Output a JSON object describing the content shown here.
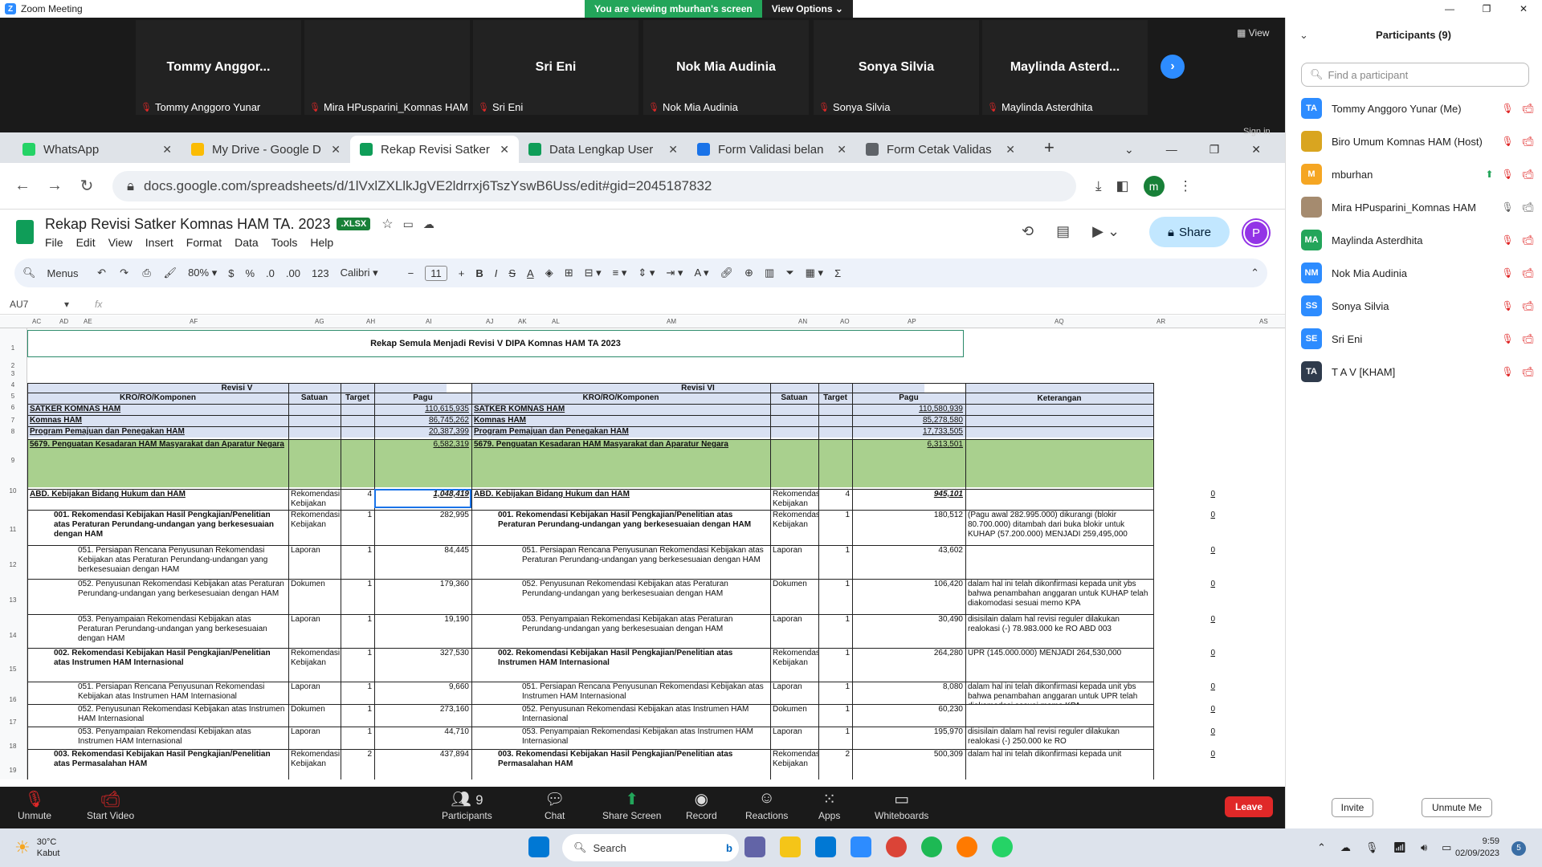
{
  "zoom": {
    "window_title": "Zoom Meeting",
    "banner_text": "You are viewing mburhan's screen",
    "view_options": "View Options",
    "view_label": "View",
    "tiles": [
      {
        "name": "Tommy  Anggor...",
        "label": "Tommy Anggoro Yunar"
      },
      {
        "name": "",
        "label": "Mira HPusparini_Komnas HAM"
      },
      {
        "name": "Sri Eni",
        "label": "Sri Eni"
      },
      {
        "name": "Nok Mia Audinia",
        "label": "Nok Mia Audinia"
      },
      {
        "name": "Sonya Silvia",
        "label": "Sonya Silvia"
      },
      {
        "name": "Maylinda  Asterd...",
        "label": "Maylinda Asterdhita"
      }
    ],
    "toolbar": {
      "unmute": "Unmute",
      "start_video": "Start Video",
      "participants": "Participants",
      "participants_count": "9",
      "chat": "Chat",
      "share_screen": "Share Screen",
      "record": "Record",
      "reactions": "Reactions",
      "apps": "Apps",
      "whiteboards": "Whiteboards",
      "leave": "Leave"
    }
  },
  "participants_panel": {
    "title": "Participants (9)",
    "search_placeholder": "Find a participant",
    "items": [
      {
        "initials": "TA",
        "name": "Tommy Anggoro Yunar (Me)",
        "color": "#2d8cff"
      },
      {
        "initials": "",
        "name": "Biro Umum Komnas HAM (Host)",
        "color": "#d9a520"
      },
      {
        "initials": "M",
        "name": "mburhan",
        "color": "#f5a623"
      },
      {
        "initials": "",
        "name": "Mira HPusparini_Komnas HAM",
        "color": "#a58b6f"
      },
      {
        "initials": "MA",
        "name": "Maylinda Asterdhita",
        "color": "#23a55a"
      },
      {
        "initials": "NM",
        "name": "Nok Mia Audinia",
        "color": "#2d8cff"
      },
      {
        "initials": "SS",
        "name": "Sonya Silvia",
        "color": "#2d8cff"
      },
      {
        "initials": "SE",
        "name": "Sri Eni",
        "color": "#2d8cff"
      },
      {
        "initials": "TA",
        "name": "T A V [KHAM]",
        "color": "#2f3b4c"
      }
    ],
    "invite": "Invite",
    "unmute_me": "Unmute Me"
  },
  "browser": {
    "tabs": [
      {
        "title": "WhatsApp",
        "color": "#25d366"
      },
      {
        "title": "My Drive - Google D",
        "color": "#fbbc04"
      },
      {
        "title": "Rekap Revisi Satker",
        "color": "#0f9d58"
      },
      {
        "title": "Data Lengkap User",
        "color": "#0f9d58"
      },
      {
        "title": "Form Validasi belan",
        "color": "#1a73e8"
      },
      {
        "title": "Form Cetak Validas",
        "color": "#5f6368"
      }
    ],
    "sign_in": "Sign in",
    "url": "docs.google.com/spreadsheets/d/1lVxlZXLlkJgVE2ldrrxj6TszYswB6Uss/edit#gid=2045187832",
    "profile_initial": "m"
  },
  "sheet": {
    "title": "Rekap Revisi Satker Komnas HAM TA. 2023",
    "badge": ".XLSX",
    "menus": [
      "File",
      "Edit",
      "View",
      "Insert",
      "Format",
      "Data",
      "Tools",
      "Help"
    ],
    "share": "Share",
    "avatar": "P",
    "toolbar": {
      "menus": "Menus",
      "zoom": "80%",
      "font": "Calibri",
      "size": "11",
      "currency": "$",
      "percent": "%",
      "dec_less": ".0",
      "dec_more": ".00",
      "fmt": "123"
    },
    "cell_ref": "AU7",
    "fx": "fx",
    "col_headers": [
      "AC",
      "AD",
      "AE",
      "AF",
      "AG",
      "AH",
      "AI",
      "AJ",
      "AK",
      "AL",
      "AM",
      "AN",
      "AO",
      "AP",
      "AQ",
      "AR",
      "AS"
    ],
    "row_numbers": [
      "1",
      "2",
      "3",
      "4",
      "5",
      "6",
      "7",
      "8",
      "9",
      "10",
      "11",
      "12",
      "13",
      "14",
      "15",
      "16",
      "17",
      "18",
      "19"
    ],
    "main_title": "Rekap Semula Menjadi Revisi V DIPA Komnas HAM TA 2023",
    "left_header": "Revisi V",
    "right_header": "Revisi VI",
    "col_kro": "KRO/RO/Komponen",
    "col_satuan": "Satuan",
    "col_target": "Target",
    "col_pagu": "Pagu",
    "col_ket": "Keterangan",
    "rows": [
      {
        "l": "SATKER KOMNAS HAM",
        "lp": "110,615,935",
        "r": "SATKER KOMNAS HAM",
        "rp": "110,580,939"
      },
      {
        "l": "Komnas HAM",
        "lp": "86,745,262",
        "r": "Komnas HAM",
        "rp": "85,278,580"
      },
      {
        "l": "Program Pemajuan dan Penegakan HAM",
        "lp": "20,387,399",
        "r": "Program Pemajuan dan Penegakan HAM",
        "rp": "17,733,505"
      },
      {
        "l": "5679. Penguatan Kesadaran HAM Masyarakat dan Aparatur Negara",
        "lp": "6,582,319",
        "r": "5679. Penguatan Kesadaran HAM Masyarakat dan Aparatur Negara",
        "rp": "6,313,501"
      },
      {
        "l": "ABD. Kebijakan Bidang Hukum dan HAM",
        "ls": "Rekomendasi Kebijakan",
        "lt": "4",
        "lp": "1,048,419",
        "r": "ABD. Kebijakan Bidang Hukum dan HAM",
        "rs": "Rekomendasi Kebijakan",
        "rt": "4",
        "rp": "945,101",
        "z": "0"
      },
      {
        "l": "001. Rekomendasi Kebijakan Hasil Pengkajian/Penelitian atas Peraturan Perundang-undangan yang berkesesuaian dengan HAM",
        "ls": "Rekomendasi Kebijakan",
        "lt": "1",
        "lp": "282,995",
        "r": "001. Rekomendasi Kebijakan Hasil Pengkajian/Penelitian atas Peraturan Perundang-undangan yang berkesesuaian dengan HAM",
        "rs": "Rekomendasi Kebijakan",
        "rt": "1",
        "rp": "180,512",
        "k": "(Pagu awal 282.995.000) dikurangi (blokir 80.700.000) ditambah dari buka blokir untuk KUHAP (57.200.000) MENJADI 259,495,000",
        "z": "0"
      },
      {
        "l": "051. Persiapan Rencana Penyusunan Rekomendasi Kebijakan atas Peraturan Perundang-undangan yang berkesesuaian dengan HAM",
        "ls": "Laporan",
        "lt": "1",
        "lp": "84,445",
        "r": "051. Persiapan Rencana Penyusunan Rekomendasi Kebijakan atas Peraturan Perundang-undangan yang berkesesuaian dengan HAM",
        "rs": "Laporan",
        "rt": "1",
        "rp": "43,602",
        "k": "",
        "z": "0"
      },
      {
        "l": "052. Penyusunan Rekomendasi Kebijakan atas Peraturan Perundang-undangan yang berkesesuaian dengan HAM",
        "ls": "Dokumen",
        "lt": "1",
        "lp": "179,360",
        "r": "052. Penyusunan Rekomendasi Kebijakan atas Peraturan Perundang-undangan yang berkesesuaian dengan HAM",
        "rs": "Dokumen",
        "rt": "1",
        "rp": "106,420",
        "k": "dalam hal ini telah dikonfirmasi kepada unit ybs bahwa penambahan anggaran untuk KUHAP telah diakomodasi sesuai memo KPA",
        "z": "0"
      },
      {
        "l": "053. Penyampaian Rekomendasi Kebijakan atas Peraturan Perundang-undangan yang berkesesuaian dengan HAM",
        "ls": "Laporan",
        "lt": "1",
        "lp": "19,190",
        "r": "053. Penyampaian Rekomendasi Kebijakan atas Peraturan Perundang-undangan yang berkesesuaian dengan HAM",
        "rs": "Laporan",
        "rt": "1",
        "rp": "30,490",
        "k": "disisilain dalam hal revisi reguler dilakukan realokasi (-) 78.983.000 ke RO ABD 003",
        "z": "0"
      },
      {
        "l": "002. Rekomendasi Kebijakan Hasil Pengkajian/Penelitian atas Instrumen HAM Internasional",
        "ls": "Rekomendasi Kebijakan",
        "lt": "1",
        "lp": "327,530",
        "r": "002. Rekomendasi Kebijakan Hasil Pengkajian/Penelitian atas Instrumen HAM Internasional",
        "rs": "Rekomendasi Kebijakan",
        "rt": "1",
        "rp": "264,280",
        "k": "UPR (145.000.000) MENJADI 264,530,000",
        "z": "0"
      },
      {
        "l": "051. Persiapan Rencana Penyusunan Rekomendasi Kebijakan atas Instrumen HAM Internasional",
        "ls": "Laporan",
        "lt": "1",
        "lp": "9,660",
        "r": "051. Persiapan Rencana Penyusunan Rekomendasi Kebijakan atas Instrumen HAM Internasional",
        "rs": "Laporan",
        "rt": "1",
        "rp": "8,080",
        "k": "dalam hal ini telah dikonfirmasi kepada unit ybs bahwa penambahan anggaran untuk UPR telah diakomodasi sesuai memo KPA",
        "z": "0"
      },
      {
        "l": "052. Penyusunan Rekomendasi Kebijakan atas Instrumen HAM Internasional",
        "ls": "Dokumen",
        "lt": "1",
        "lp": "273,160",
        "r": "052. Penyusunan Rekomendasi Kebijakan atas Instrumen HAM Internasional",
        "rs": "Dokumen",
        "rt": "1",
        "rp": "60,230",
        "k": "",
        "z": "0"
      },
      {
        "l": "053. Penyampaian Rekomendasi Kebijakan atas Instrumen HAM Internasional",
        "ls": "Laporan",
        "lt": "1",
        "lp": "44,710",
        "r": "053. Penyampaian Rekomendasi Kebijakan atas Instrumen HAM Internasional",
        "rs": "Laporan",
        "rt": "1",
        "rp": "195,970",
        "k": "disisilain dalam hal revisi reguler dilakukan realokasi (-) 250.000 ke RO",
        "z": "0"
      },
      {
        "l": "003. Rekomendasi Kebijakan Hasil Pengkajian/Penelitian atas Permasalahan HAM",
        "ls": "Rekomendasi Kebijakan",
        "lt": "2",
        "lp": "437,894",
        "r": "003. Rekomendasi Kebijakan Hasil Pengkajian/Penelitian atas Permasalahan HAM",
        "rs": "Rekomendasi Kebijakan",
        "rt": "2",
        "rp": "500,309",
        "k": "dalam hal ini telah dikonfirmasi kepada unit",
        "z": "0"
      }
    ]
  },
  "taskbar": {
    "weather_temp": "30°C",
    "weather_desc": "Kabut",
    "search": "Search",
    "time": "9:59",
    "date": "02/09/2023",
    "badge": "5"
  }
}
